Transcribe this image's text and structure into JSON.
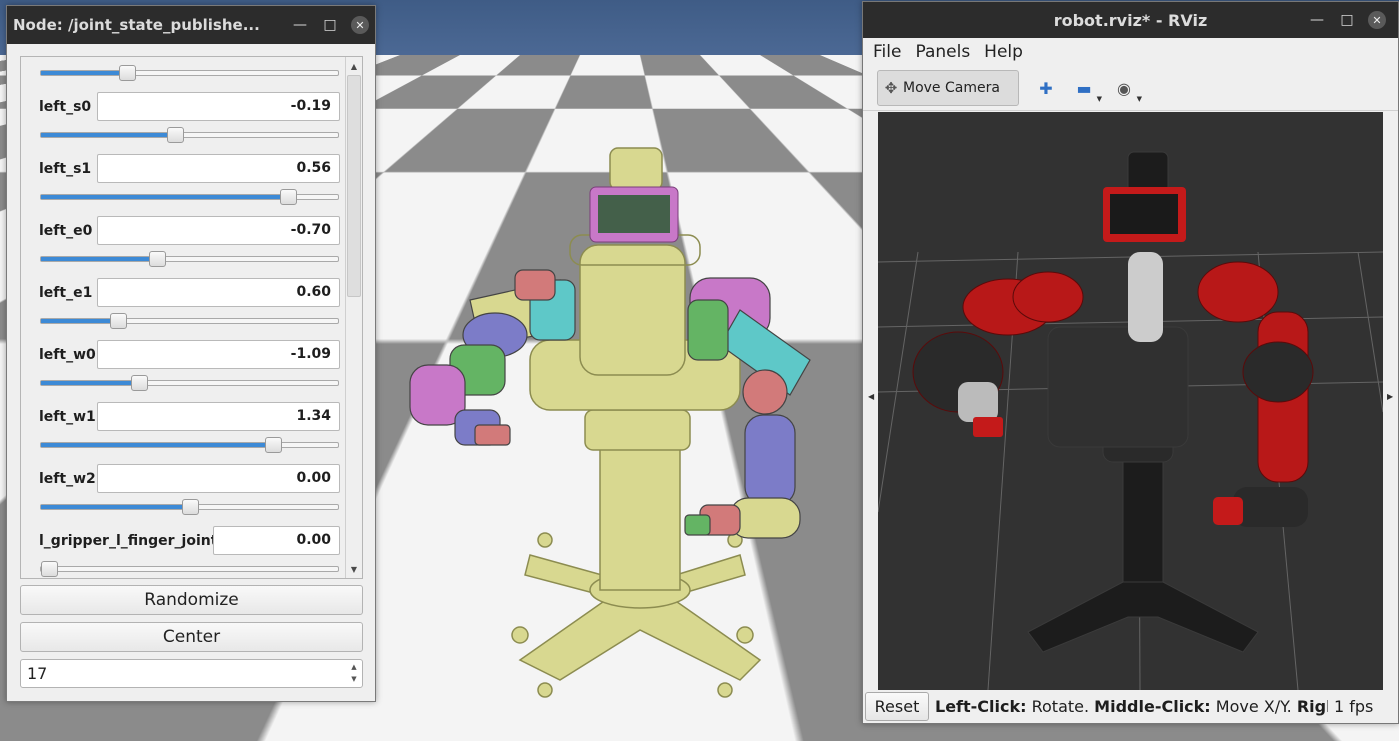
{
  "jsp_window": {
    "title": "Node: /joint_state_publishe...",
    "minimize_icon": "minimize-icon",
    "maximize_icon": "maximize-icon",
    "close_icon": "close-icon",
    "joints": [
      {
        "name": "",
        "value": "",
        "slider_fraction": 0.29
      },
      {
        "name": "left_s0",
        "value": "-0.19",
        "slider_fraction": 0.45
      },
      {
        "name": "left_s1",
        "value": "0.56",
        "slider_fraction": 0.83
      },
      {
        "name": "left_e0",
        "value": "-0.70",
        "slider_fraction": 0.39
      },
      {
        "name": "left_e1",
        "value": "0.60",
        "slider_fraction": 0.26
      },
      {
        "name": "left_w0",
        "value": "-1.09",
        "slider_fraction": 0.33
      },
      {
        "name": "left_w1",
        "value": "1.34",
        "slider_fraction": 0.78
      },
      {
        "name": "left_w2",
        "value": "0.00",
        "slider_fraction": 0.5
      },
      {
        "name": "l_gripper_l_finger_joint",
        "value": "0.00",
        "slider_fraction": 0.0
      }
    ],
    "randomize_label": "Randomize",
    "center_label": "Center",
    "spin_value": "17"
  },
  "rviz_window": {
    "title": "robot.rviz* - RViz",
    "menu": {
      "file": "File",
      "panels": "Panels",
      "help": "Help"
    },
    "toolbar": {
      "move_camera_label": "Move Camera",
      "move_camera_icon": "move-camera-icon",
      "add_icon": "plus-icon",
      "remove_icon": "minus-icon",
      "view_icon": "eye-icon"
    },
    "status": {
      "reset_label": "Reset",
      "left_click_key": "Left-Click:",
      "left_click_text": " Rotate. ",
      "middle_click_key": "Middle-Click:",
      "middle_click_text": " Move X/Y. ",
      "right_click_key": "Righ",
      "fps": "1 fps"
    }
  },
  "colors": {
    "slider_fill": "#3d8ad6",
    "titlebar": "#2c2c2c",
    "robot_body": "#d6d68c",
    "robot_red": "#c41a1a"
  }
}
